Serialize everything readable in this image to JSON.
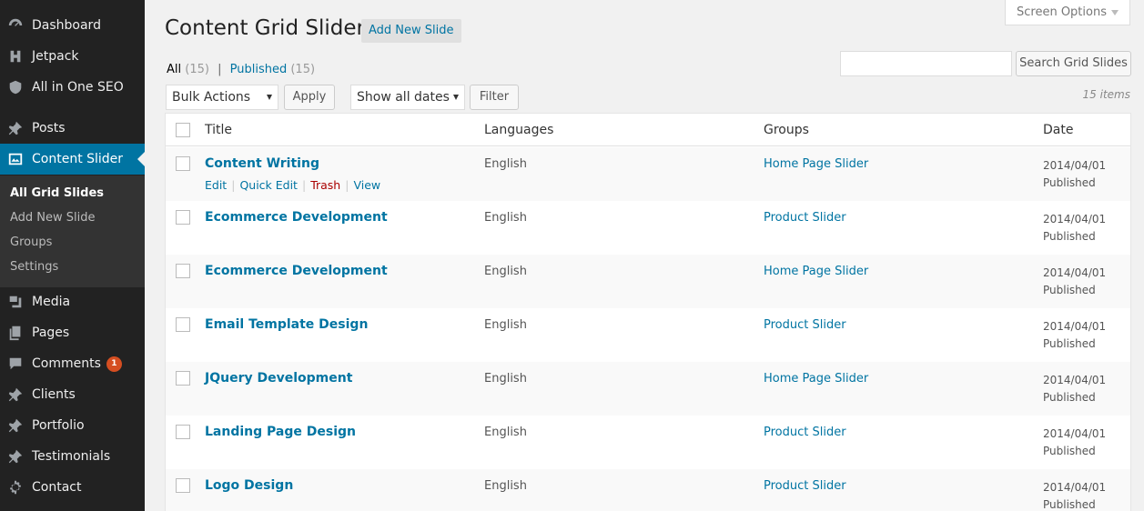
{
  "sidebar": {
    "items": [
      {
        "label": "Dashboard",
        "icon": "dashboard-icon"
      },
      {
        "label": "Jetpack",
        "icon": "jetpack-icon"
      },
      {
        "label": "All in One SEO",
        "icon": "shield-icon"
      },
      {
        "label": "Posts",
        "icon": "pin-icon"
      },
      {
        "label": "Content Slider",
        "icon": "slider-icon",
        "active": true
      },
      {
        "label": "Media",
        "icon": "media-icon"
      },
      {
        "label": "Pages",
        "icon": "pages-icon"
      },
      {
        "label": "Comments",
        "icon": "comment-icon",
        "badge": "1"
      },
      {
        "label": "Clients",
        "icon": "pin-icon"
      },
      {
        "label": "Portfolio",
        "icon": "pin-icon"
      },
      {
        "label": "Testimonials",
        "icon": "pin-icon"
      },
      {
        "label": "Contact",
        "icon": "gear-icon"
      }
    ],
    "submenu": [
      {
        "label": "All Grid Slides",
        "current": true
      },
      {
        "label": "Add New Slide"
      },
      {
        "label": "Groups"
      },
      {
        "label": "Settings"
      }
    ]
  },
  "header": {
    "title": "Content Grid Slider",
    "add_new_label": "Add New Slide",
    "screen_options_label": "Screen Options"
  },
  "filters": {
    "all_label": "All",
    "all_count": "(15)",
    "separator": "|",
    "published_label": "Published",
    "published_count": "(15)"
  },
  "search": {
    "placeholder": "",
    "button_label": "Search Grid Slides"
  },
  "toolbar": {
    "bulk_actions_value": "Bulk Actions",
    "apply_label": "Apply",
    "dates_value": "Show all dates",
    "filter_label": "Filter",
    "items_count": "15 items"
  },
  "table": {
    "columns": [
      "Title",
      "Languages",
      "Groups",
      "Date"
    ],
    "row_actions": {
      "edit": "Edit",
      "quick_edit": "Quick Edit",
      "trash": "Trash",
      "view": "View"
    },
    "rows": [
      {
        "title": "Content Writing",
        "language": "English",
        "group": "Home Page Slider",
        "date": "2014/04/01",
        "status": "Published"
      },
      {
        "title": "Ecommerce Development",
        "language": "English",
        "group": "Product Slider",
        "date": "2014/04/01",
        "status": "Published"
      },
      {
        "title": "Ecommerce Development",
        "language": "English",
        "group": "Home Page Slider",
        "date": "2014/04/01",
        "status": "Published"
      },
      {
        "title": "Email Template Design",
        "language": "English",
        "group": "Product Slider",
        "date": "2014/04/01",
        "status": "Published"
      },
      {
        "title": "JQuery Development",
        "language": "English",
        "group": "Home Page Slider",
        "date": "2014/04/01",
        "status": "Published"
      },
      {
        "title": "Landing Page Design",
        "language": "English",
        "group": "Product Slider",
        "date": "2014/04/01",
        "status": "Published"
      },
      {
        "title": "Logo Design",
        "language": "English",
        "group": "Product Slider",
        "date": "2014/04/01",
        "status": "Published"
      }
    ]
  },
  "colors": {
    "sidebar_bg": "#222222",
    "active_bg": "#0074a2",
    "link": "#0074a2",
    "badge": "#d54e21",
    "trash": "#aa0000"
  }
}
